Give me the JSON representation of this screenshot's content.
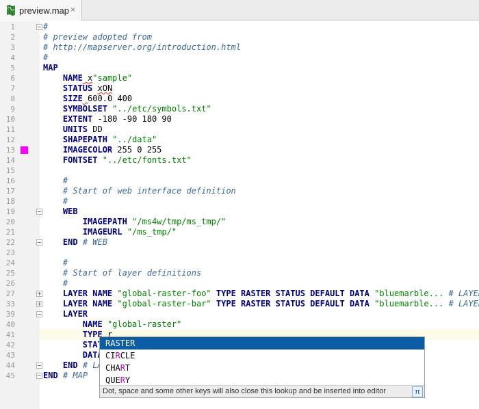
{
  "tab": {
    "filename": "preview.map",
    "close": "×"
  },
  "current_line": 41,
  "lines": [
    {
      "n": "1",
      "parts": [
        {
          "t": "#",
          "c": "cmt-blue"
        }
      ]
    },
    {
      "n": "2",
      "parts": [
        {
          "t": "# preview adopted from",
          "c": "cmt-blue"
        }
      ]
    },
    {
      "n": "3",
      "parts": [
        {
          "t": "# http://mapserver.org/introduction.html",
          "c": "cmt-blue"
        }
      ]
    },
    {
      "n": "4",
      "parts": [
        {
          "t": "#",
          "c": "cmt-blue"
        }
      ]
    },
    {
      "n": "5",
      "parts": [
        {
          "t": "MAP",
          "c": "kw"
        }
      ]
    },
    {
      "n": "6",
      "parts": [
        {
          "t": "    "
        },
        {
          "t": "NAME",
          "c": "kw"
        },
        {
          "t": " x",
          "c": "squig"
        },
        {
          "t": "\"sample\"",
          "c": "str"
        }
      ]
    },
    {
      "n": "7",
      "parts": [
        {
          "t": "    "
        },
        {
          "t": "STATUS",
          "c": "kw"
        },
        {
          "t": " "
        },
        {
          "t": "xON",
          "c": "squig"
        }
      ]
    },
    {
      "n": "8",
      "parts": [
        {
          "t": "    "
        },
        {
          "t": "SIZE",
          "c": "kw"
        },
        {
          "t": " ",
          "c": "squig"
        },
        {
          "t": "600.0 400"
        }
      ]
    },
    {
      "n": "9",
      "parts": [
        {
          "t": "    "
        },
        {
          "t": "SYMBOLSET",
          "c": "kw"
        },
        {
          "t": " "
        },
        {
          "t": "\"../etc/symbols.txt\"",
          "c": "str"
        }
      ]
    },
    {
      "n": "10",
      "parts": [
        {
          "t": "    "
        },
        {
          "t": "EXTENT",
          "c": "kw"
        },
        {
          "t": " -180 -90 180 90"
        }
      ]
    },
    {
      "n": "11",
      "parts": [
        {
          "t": "    "
        },
        {
          "t": "UNITS",
          "c": "kw"
        },
        {
          "t": " DD"
        }
      ]
    },
    {
      "n": "12",
      "parts": [
        {
          "t": "    "
        },
        {
          "t": "SHAPEPATH",
          "c": "kw"
        },
        {
          "t": " "
        },
        {
          "t": "\"../data\"",
          "c": "str"
        }
      ]
    },
    {
      "n": "13",
      "parts": [
        {
          "t": "    "
        },
        {
          "t": "IMAGECOLOR",
          "c": "kw"
        },
        {
          "t": " 255 0 255"
        }
      ]
    },
    {
      "n": "14",
      "parts": [
        {
          "t": "    "
        },
        {
          "t": "FONTSET",
          "c": "kw"
        },
        {
          "t": " "
        },
        {
          "t": "\"../etc/fonts.txt\"",
          "c": "str"
        }
      ]
    },
    {
      "n": "15",
      "parts": []
    },
    {
      "n": "16",
      "parts": [
        {
          "t": "    "
        },
        {
          "t": "#",
          "c": "cmt-blue"
        }
      ]
    },
    {
      "n": "17",
      "parts": [
        {
          "t": "    "
        },
        {
          "t": "# Start of web interface definition",
          "c": "cmt-blue"
        }
      ]
    },
    {
      "n": "18",
      "parts": [
        {
          "t": "    "
        },
        {
          "t": "#",
          "c": "cmt-blue"
        }
      ]
    },
    {
      "n": "19",
      "parts": [
        {
          "t": "    "
        },
        {
          "t": "WEB",
          "c": "kw"
        }
      ]
    },
    {
      "n": "20",
      "parts": [
        {
          "t": "        "
        },
        {
          "t": "IMAGEPATH",
          "c": "kw"
        },
        {
          "t": " "
        },
        {
          "t": "\"/ms4w/tmp/ms_tmp/\"",
          "c": "str"
        }
      ]
    },
    {
      "n": "21",
      "parts": [
        {
          "t": "        "
        },
        {
          "t": "IMAGEURL",
          "c": "kw"
        },
        {
          "t": " "
        },
        {
          "t": "\"/ms_tmp/\"",
          "c": "str"
        }
      ]
    },
    {
      "n": "22",
      "parts": [
        {
          "t": "    "
        },
        {
          "t": "END",
          "c": "kw"
        },
        {
          "t": " "
        },
        {
          "t": "# WEB",
          "c": "cmt-blue"
        }
      ]
    },
    {
      "n": "23",
      "parts": []
    },
    {
      "n": "24",
      "parts": [
        {
          "t": "    "
        },
        {
          "t": "#",
          "c": "cmt-blue"
        }
      ]
    },
    {
      "n": "25",
      "parts": [
        {
          "t": "    "
        },
        {
          "t": "# Start of layer definitions",
          "c": "cmt-blue"
        }
      ]
    },
    {
      "n": "26",
      "parts": [
        {
          "t": "    "
        },
        {
          "t": "#",
          "c": "cmt-blue"
        }
      ]
    },
    {
      "n": "27",
      "parts": [
        {
          "t": "    "
        },
        {
          "t": "LAYER NAME",
          "c": "kw"
        },
        {
          "t": " "
        },
        {
          "t": "\"global-raster-foo\"",
          "c": "str"
        },
        {
          "t": " "
        },
        {
          "t": "TYPE RASTER STATUS DEFAULT DATA",
          "c": "kw"
        },
        {
          "t": " "
        },
        {
          "t": "\"bluemarble...",
          "c": "str"
        },
        {
          "t": " "
        },
        {
          "t": "# LAYER",
          "c": "cmt-blue"
        }
      ]
    },
    {
      "n": "33",
      "parts": [
        {
          "t": "    "
        },
        {
          "t": "LAYER NAME",
          "c": "kw"
        },
        {
          "t": " "
        },
        {
          "t": "\"global-raster-bar\"",
          "c": "str"
        },
        {
          "t": " "
        },
        {
          "t": "TYPE RASTER STATUS DEFAULT DATA",
          "c": "kw"
        },
        {
          "t": " "
        },
        {
          "t": "\"bluemarble...",
          "c": "str"
        },
        {
          "t": " "
        },
        {
          "t": "# LAYER",
          "c": "cmt-blue"
        }
      ]
    },
    {
      "n": "39",
      "parts": [
        {
          "t": "    "
        },
        {
          "t": "LAYER",
          "c": "kw"
        }
      ]
    },
    {
      "n": "40",
      "parts": [
        {
          "t": "        "
        },
        {
          "t": "NAME",
          "c": "kw"
        },
        {
          "t": " "
        },
        {
          "t": "\"global-raster\"",
          "c": "str"
        }
      ]
    },
    {
      "n": "41",
      "parts": [
        {
          "t": "        "
        },
        {
          "t": "TYPE",
          "c": "kw"
        },
        {
          "t": " r"
        }
      ]
    },
    {
      "n": "42",
      "parts": [
        {
          "t": "        "
        },
        {
          "t": "STAT",
          "c": "kw"
        }
      ]
    },
    {
      "n": "43",
      "parts": [
        {
          "t": "        "
        },
        {
          "t": "DATA",
          "c": "kw"
        }
      ]
    },
    {
      "n": "44",
      "parts": [
        {
          "t": "    "
        },
        {
          "t": "END",
          "c": "kw"
        },
        {
          "t": " "
        },
        {
          "t": "# LA",
          "c": "cmt-blue"
        }
      ]
    },
    {
      "n": "45",
      "parts": [
        {
          "t": "END",
          "c": "kw"
        },
        {
          "t": " "
        },
        {
          "t": "# MAP",
          "c": "cmt-blue"
        }
      ]
    }
  ],
  "completion": {
    "items": [
      {
        "pre": "",
        "hl": "R",
        "post": "ASTER",
        "selected": true
      },
      {
        "pre": "CI",
        "hl": "R",
        "post": "CLE",
        "selected": false
      },
      {
        "pre": "CHA",
        "hl": "R",
        "post": "T",
        "selected": false
      },
      {
        "pre": "QUE",
        "hl": "R",
        "post": "Y",
        "selected": false
      }
    ],
    "footer": "Dot, space and some other keys will also close this lookup and be inserted into editor",
    "pi": "π"
  },
  "colors": {
    "magenta_marker": "#ff00ff",
    "selection": "#0d5ca6"
  }
}
